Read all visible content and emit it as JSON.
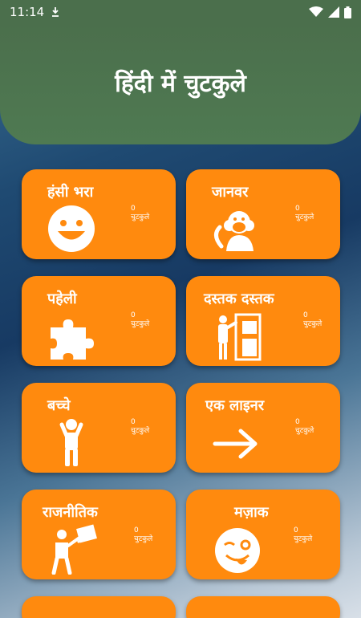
{
  "status_bar": {
    "time": "11:14"
  },
  "header": {
    "title": "हिंदी में चुटकुले"
  },
  "categories": [
    {
      "title": "हंसी भरा",
      "count": "0",
      "count_label": "चुटकुले",
      "icon": "smiley-icon"
    },
    {
      "title": "जानवर",
      "count": "0",
      "count_label": "चुटकुले",
      "icon": "monkey-icon"
    },
    {
      "title": "पहेली",
      "count": "0",
      "count_label": "चुटकुले",
      "icon": "puzzle-icon"
    },
    {
      "title": "दस्तक दस्तक",
      "count": "0",
      "count_label": "चुटकुले",
      "icon": "door-knock-icon"
    },
    {
      "title": "बच्चे",
      "count": "0",
      "count_label": "चुटकुले",
      "icon": "child-icon"
    },
    {
      "title": "एक लाइनर",
      "count": "0",
      "count_label": "चुटकुले",
      "icon": "arrow-right-icon"
    },
    {
      "title": "राजनीतिक",
      "count": "0",
      "count_label": "चुटकुले",
      "icon": "protester-icon"
    },
    {
      "title": "मज़ाक",
      "count": "0",
      "count_label": "चुटकुले",
      "icon": "winking-tongue-icon"
    }
  ],
  "colors": {
    "card": "#ff8a0e",
    "header": "#4b6f4c"
  }
}
